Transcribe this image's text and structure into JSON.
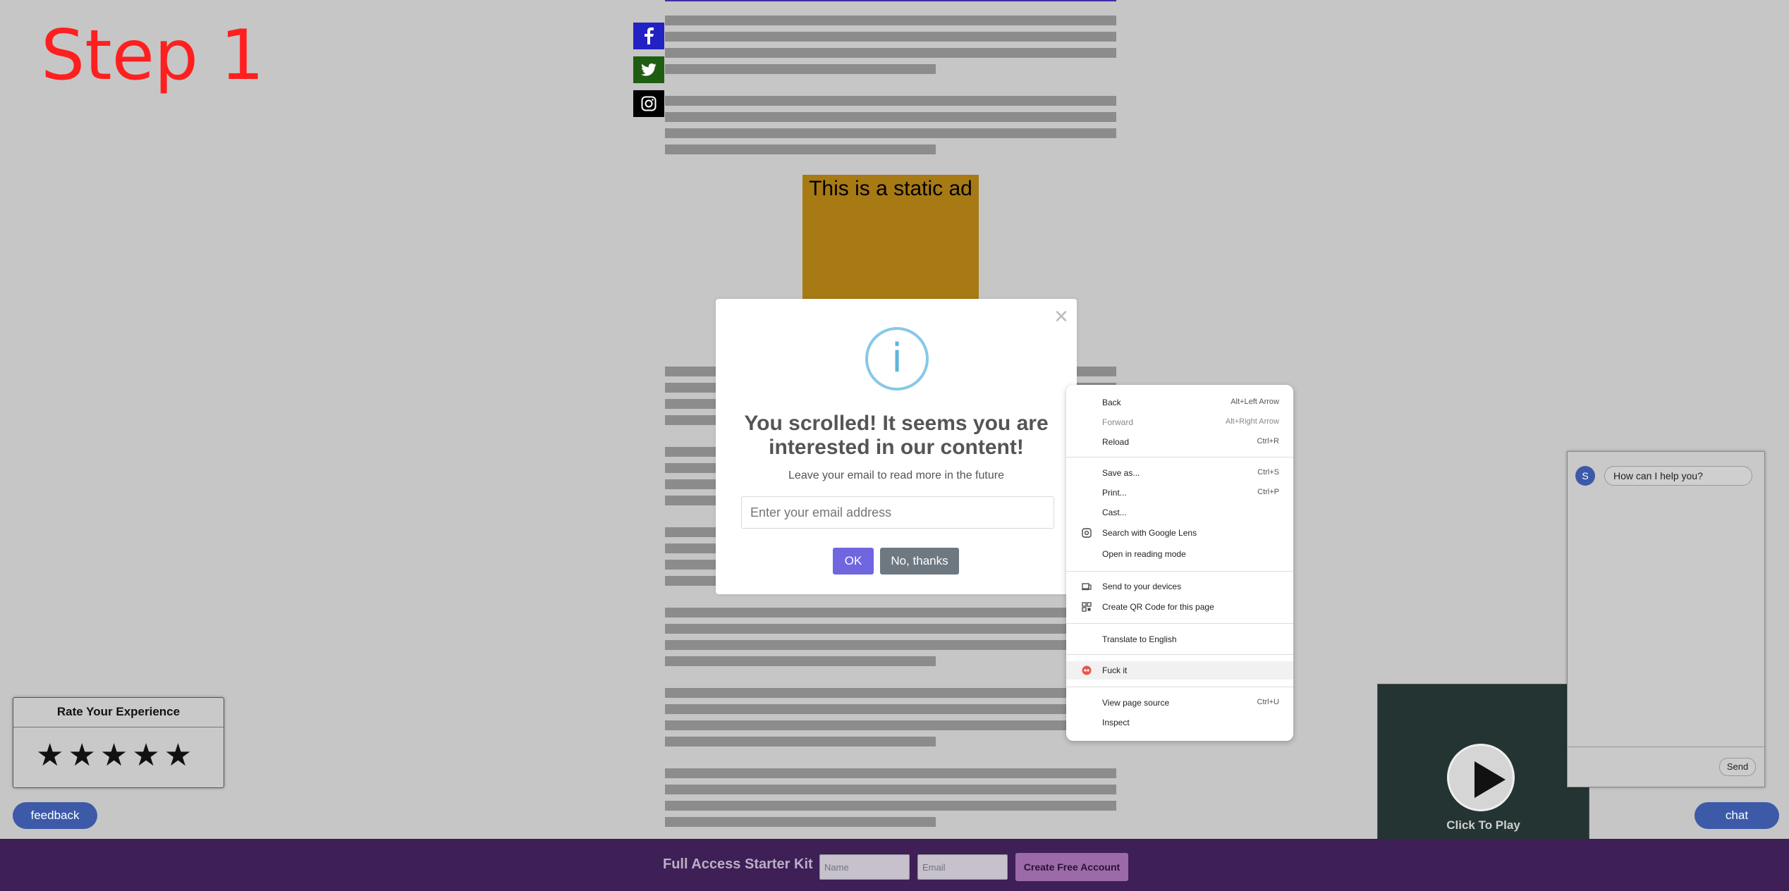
{
  "step_label": "Step 1",
  "ad": {
    "text": "This is a static ad"
  },
  "modal": {
    "close_glyph": "×",
    "info_glyph": "i",
    "title": "You scrolled! It seems you are interested in our content!",
    "subtitle": "Leave your email to read more in the future",
    "email_placeholder": "Enter your email address",
    "ok_label": "OK",
    "no_label": "No, thanks"
  },
  "context_menu": {
    "items": [
      {
        "label": "Back",
        "shortcut": "Alt+Left Arrow"
      },
      {
        "label": "Forward",
        "shortcut": "Alt+Right Arrow"
      },
      {
        "label": "Reload",
        "shortcut": "Ctrl+R"
      },
      {
        "label": "Save as...",
        "shortcut": "Ctrl+S"
      },
      {
        "label": "Print...",
        "shortcut": "Ctrl+P"
      },
      {
        "label": "Cast..."
      },
      {
        "label": "Search with Google Lens",
        "icon": "lens-icon"
      },
      {
        "label": "Open in reading mode"
      },
      {
        "label": "Send to your devices",
        "icon": "devices-icon"
      },
      {
        "label": "Create QR Code for this page",
        "icon": "qr-icon"
      },
      {
        "label": "Translate to English"
      },
      {
        "label": "Fuck it",
        "icon": "extension-icon"
      },
      {
        "label": "View page source",
        "shortcut": "Ctrl+U"
      },
      {
        "label": "Inspect"
      }
    ]
  },
  "rating": {
    "title": "Rate Your Experience",
    "stars": "★★★★★"
  },
  "feedback_label": "feedback",
  "chat_button_label": "chat",
  "chat": {
    "avatar": "S",
    "message": "How can I help you?",
    "send_label": "Send"
  },
  "video": {
    "caption": "Click To Play"
  },
  "footer": {
    "title": "Full Access Starter Kit",
    "name_placeholder": "Name",
    "email_placeholder": "Email",
    "create_label": "Create Free Account"
  }
}
